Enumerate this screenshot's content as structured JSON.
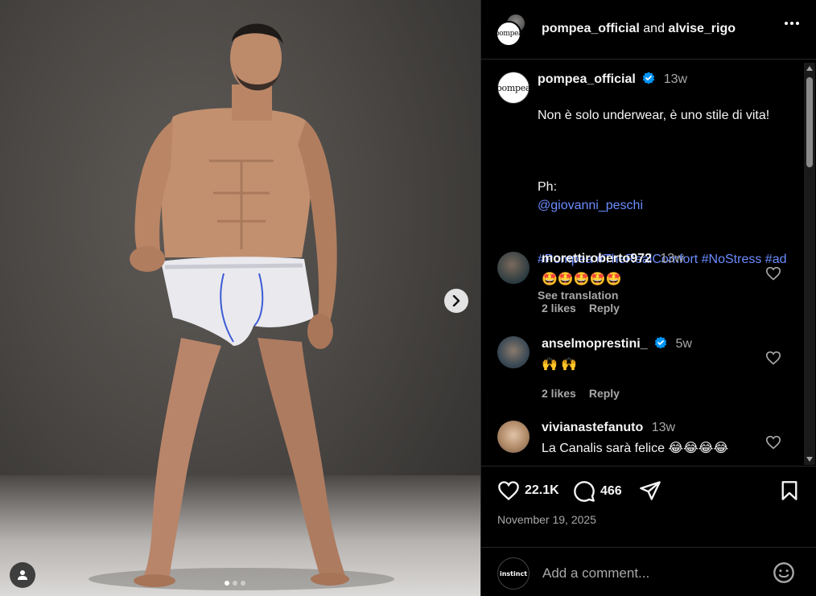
{
  "media": {
    "carousel_dots": 3,
    "active_dot": 0
  },
  "header": {
    "owner": "pompea_official",
    "joiner": "and",
    "collaborator": "alvise_rigo",
    "avatar_logo_text": "pompea"
  },
  "caption": {
    "username": "pompea_official",
    "time": "13w",
    "line1": "Non è solo underwear, è uno stile di vita!",
    "ph_label": "Ph:",
    "ph_mention": "@giovanni_peschi",
    "hashtags": "#Pompea #TheRealComfort #NoStress #ad",
    "see_translation": "See translation"
  },
  "comments": [
    {
      "username": "morettiroberto972",
      "time": "13w",
      "text": "🤩🤩🤩🤩🤩",
      "likes": "2 likes",
      "reply": "Reply",
      "verified": false
    },
    {
      "username": "anselmoprestini_",
      "time": "5w",
      "text": "🙌 🙌",
      "likes": "2 likes",
      "reply": "Reply",
      "verified": true
    },
    {
      "username": "vivianastefanuto",
      "time": "13w",
      "text": "La Canalis sarà felice 😂😂😂😂",
      "likes": "",
      "reply": "",
      "verified": false
    }
  ],
  "actions": {
    "likes_count": "22.1K",
    "comments_count": "466"
  },
  "post_date": "November 19, 2025",
  "add_comment": {
    "placeholder": "Add a comment...",
    "avatar_text": "instinct"
  },
  "colors": {
    "link": "#6b8cff",
    "verified": "#0095f6",
    "muted": "#a8a8a8"
  }
}
